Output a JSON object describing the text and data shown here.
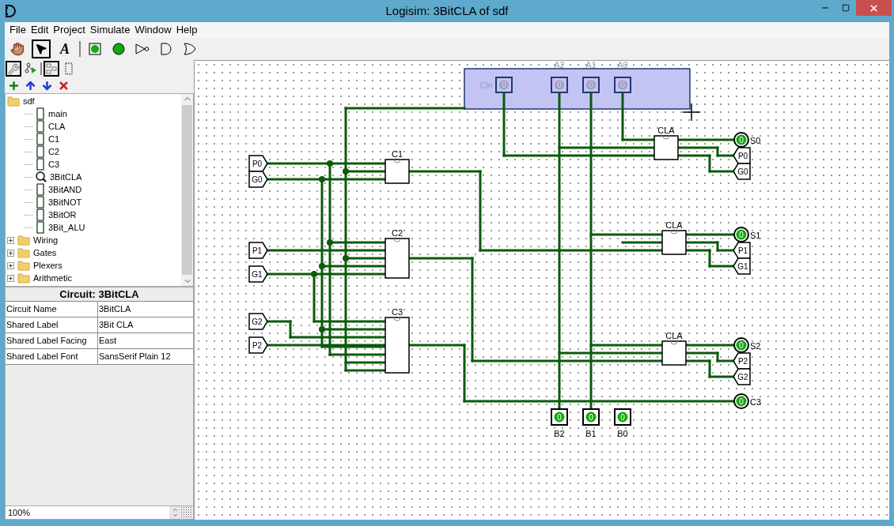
{
  "window": {
    "title": "Logisim: 3BitCLA of sdf"
  },
  "menu": [
    "File",
    "Edit",
    "Project",
    "Simulate",
    "Window",
    "Help"
  ],
  "tools": [
    {
      "kind": "hand",
      "selected": false
    },
    {
      "kind": "select",
      "selected": true
    },
    {
      "kind": "text",
      "label": "A",
      "selected": false
    },
    {
      "kind": "separator"
    },
    {
      "kind": "input",
      "selected": false
    },
    {
      "kind": "output",
      "selected": false
    },
    {
      "kind": "not",
      "selected": false
    },
    {
      "kind": "and",
      "selected": false
    },
    {
      "kind": "or",
      "selected": false
    }
  ],
  "explorer_tools": [
    {
      "kind": "tools",
      "selected": true
    },
    {
      "kind": "simulation",
      "selected": false
    },
    {
      "kind": "separator"
    },
    {
      "kind": "layout",
      "selected": true
    },
    {
      "kind": "appearance",
      "selected": false
    }
  ],
  "tree": [
    {
      "label": "sdf",
      "expanded": true,
      "children": [
        {
          "label": "main",
          "kind": "circuit",
          "current": false
        },
        {
          "label": "CLA",
          "kind": "circuit",
          "current": false
        },
        {
          "label": "C1",
          "kind": "circuit",
          "current": false
        },
        {
          "label": "C2",
          "kind": "circuit",
          "current": false
        },
        {
          "label": "C3",
          "kind": "circuit",
          "current": false
        },
        {
          "label": "3BitCLA",
          "kind": "circuit",
          "current": true
        },
        {
          "label": "3BitAND",
          "kind": "circuit",
          "current": false
        },
        {
          "label": "3BitNOT",
          "kind": "circuit",
          "current": false
        },
        {
          "label": "3BitOR",
          "kind": "circuit",
          "current": false
        },
        {
          "label": "3Bit_ALU",
          "kind": "circuit",
          "current": false
        }
      ]
    },
    {
      "label": "Wiring",
      "expanded": false
    },
    {
      "label": "Gates",
      "expanded": false
    },
    {
      "label": "Plexers",
      "expanded": false
    },
    {
      "label": "Arithmetic",
      "expanded": false
    }
  ],
  "properties": {
    "title": "Circuit: 3BitCLA",
    "rows": [
      {
        "name": "Circuit Name",
        "value": "3BitCLA"
      },
      {
        "name": "Shared Label",
        "value": "3Bit CLA"
      },
      {
        "name": "Shared Label Facing",
        "value": "East"
      },
      {
        "name": "Shared Label Font",
        "value": "SansSerif Plain 12"
      }
    ]
  },
  "zoom": "100%",
  "canvas": {
    "top_pins": [
      {
        "label": "Cin",
        "value": "0",
        "selected": true
      },
      {
        "label": "A2",
        "value": "0",
        "selected": true
      },
      {
        "label": "A1",
        "value": "0",
        "selected": true
      },
      {
        "label": "A0",
        "value": "0",
        "selected": true
      }
    ],
    "subcircuits": [
      {
        "label": "C1"
      },
      {
        "label": "C2"
      },
      {
        "label": "C3"
      },
      {
        "label": "CLA"
      },
      {
        "label": "CLA"
      },
      {
        "label": "CLA"
      }
    ],
    "input_tunnels": [
      {
        "label": "P0"
      },
      {
        "label": "G0"
      },
      {
        "label": "P1"
      },
      {
        "label": "G1"
      },
      {
        "label": "G2"
      },
      {
        "label": "P2"
      }
    ],
    "output_pins": [
      {
        "label": "S0",
        "value": "0"
      },
      {
        "label": "S1",
        "value": "0"
      },
      {
        "label": "S2",
        "value": "0"
      },
      {
        "label": "C3",
        "value": "0"
      }
    ],
    "output_tunnels": [
      {
        "label": "P0"
      },
      {
        "label": "G0"
      },
      {
        "label": "P1"
      },
      {
        "label": "G1"
      },
      {
        "label": "P2"
      },
      {
        "label": "G2"
      }
    ],
    "bottom_pins": [
      {
        "label": "B2",
        "value": "0"
      },
      {
        "label": "B1",
        "value": "0"
      },
      {
        "label": "B0",
        "value": "0"
      }
    ]
  }
}
